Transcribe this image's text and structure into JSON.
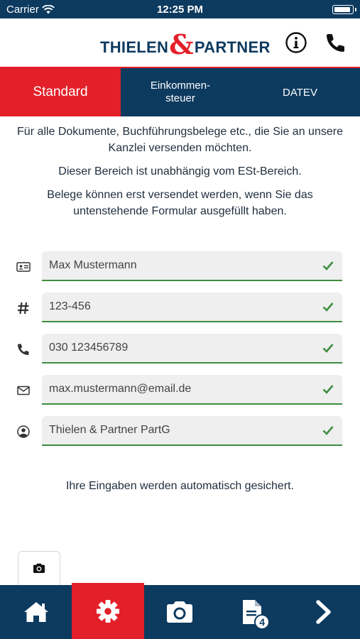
{
  "status_bar": {
    "carrier": "Carrier",
    "time": "12:25 PM"
  },
  "header": {
    "logo_left": "THIELEN",
    "logo_amp": "&",
    "logo_right": "PARTNER",
    "icons": [
      "info-icon",
      "phone-icon"
    ]
  },
  "tabs": [
    {
      "label": "Standard",
      "active": true
    },
    {
      "label": "Einkommen-\nsteuer",
      "active": false
    },
    {
      "label": "DATEV",
      "active": false
    }
  ],
  "intro": {
    "p1": "Für alle Dokumente, Buchführungsbelege etc., die Sie an unsere Kanzlei versenden möchten.",
    "p2": "Dieser Bereich ist unabhängig vom ESt-Bereich.",
    "p3": "Belege können erst versendet werden, wenn Sie das untenstehende Formular ausgefüllt haben."
  },
  "form": {
    "name": {
      "icon": "id-card-icon",
      "value": "Max Mustermann"
    },
    "number": {
      "icon": "hash-icon",
      "value": "123-456"
    },
    "phone": {
      "icon": "phone-icon",
      "value": "030 123456789"
    },
    "email": {
      "icon": "mail-icon",
      "value": "max.mustermann@email.de"
    },
    "company": {
      "icon": "user-circle-icon",
      "value": "Thielen & Partner PartG"
    }
  },
  "autosave_note": "Ihre Eingaben werden automatisch gesichert.",
  "bottom_nav": {
    "items": [
      "home-icon",
      "gear-icon",
      "camera-icon",
      "documents-icon",
      "chevron-right-icon"
    ],
    "active": "gear-icon",
    "documents_badge": "4"
  },
  "colors": {
    "navy": "#0d3a5f",
    "red": "#e3202a",
    "green": "#3e8e3e"
  }
}
